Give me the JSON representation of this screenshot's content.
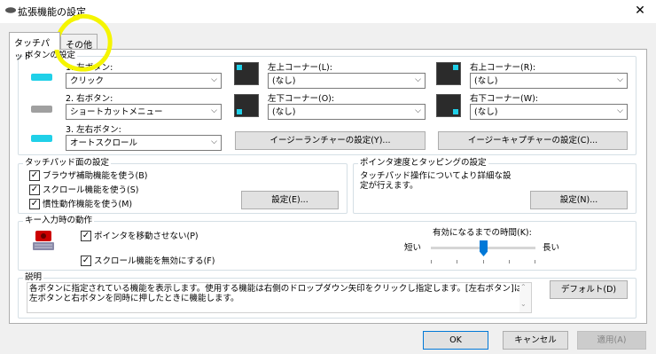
{
  "window": {
    "title": "拡張機能の設定",
    "close": "✕"
  },
  "tabs": [
    {
      "label": "タッチパッド"
    },
    {
      "label": "その他"
    }
  ],
  "button_settings": {
    "group_title": "ボタンの設定",
    "left": {
      "label": "1. 左ボタン:",
      "value": "クリック"
    },
    "right": {
      "label": "2. 右ボタン:",
      "value": "ショートカットメニュー"
    },
    "both": {
      "label": "3. 左右ボタン:",
      "value": "オートスクロール"
    },
    "top_left": {
      "label": "左上コーナー(L):",
      "value": "(なし)"
    },
    "bottom_left": {
      "label": "左下コーナー(O):",
      "value": "(なし)"
    },
    "top_right": {
      "label": "右上コーナー(R):",
      "value": "(なし)"
    },
    "bottom_right": {
      "label": "右下コーナー(W):",
      "value": "(なし)"
    },
    "easy_launcher_button": "イージーランチャーの設定(Y)...",
    "easy_capture_button": "イージーキャプチャーの設定(C)..."
  },
  "touch_surface": {
    "group_title": "タッチパッド面の設定",
    "browser_assist": "ブラウザ補助機能を使う(B)",
    "scroll": "スクロール機能を使う(S)",
    "inertia": "慣性動作機能を使う(M)",
    "settings_button": "設定(E)..."
  },
  "pointer_speed": {
    "group_title": "ポインタ速度とタッピングの設定",
    "description": "タッチパッド操作についてより詳細な設定が行えます。",
    "settings_button": "設定(N)..."
  },
  "key_input": {
    "group_title": "キー入力時の動作",
    "no_move_pointer": "ポインタを移動させない(P)",
    "disable_scroll": "スクロール機能を無効にする(F)",
    "delay_label": "有効になるまでの時間(K):",
    "short": "短い",
    "long": "長い",
    "slider_level": 0.5
  },
  "description": {
    "group_title": "説明",
    "text_line1": "各ボタンに指定されている機能を表示します。使用する機能は右側のドロップダウン矢印をクリックし指定します。[左右ボタン]は、",
    "text_line2": "左ボタンと右ボタンを同時に押したときに機能します。",
    "default_button": "デフォルト(D)"
  },
  "footer": {
    "ok": "OK",
    "cancel": "キャンセル",
    "apply": "適用(A)"
  },
  "colors": {
    "accent": "#20d0e8",
    "annotation": "#f5f500",
    "slider_thumb": "#0078d7"
  }
}
